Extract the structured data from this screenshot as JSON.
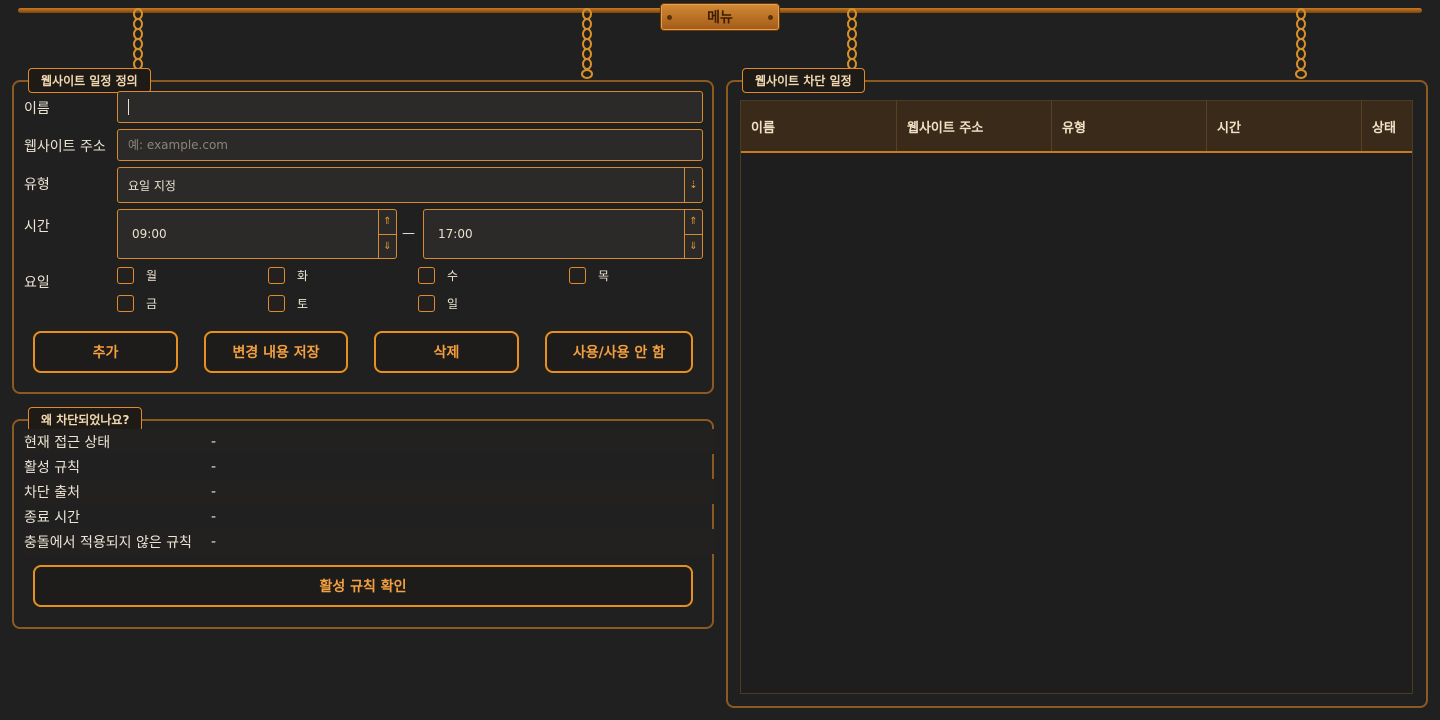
{
  "menu": {
    "title": "메뉴"
  },
  "definition_panel": {
    "title": "웹사이트 일정 정의",
    "name_label": "이름",
    "name_value": "",
    "url_label": "웹사이트 주소",
    "url_placeholder": "예: example.com",
    "type_label": "유형",
    "type_value": "요일 지정",
    "time_label": "시간",
    "time_start": "09:00",
    "time_end": "17:00",
    "time_separator": "—",
    "days_label": "요일",
    "days": [
      "월",
      "화",
      "수",
      "목",
      "금",
      "토",
      "일"
    ],
    "buttons": {
      "add": "추가",
      "save": "변경 내용 저장",
      "delete": "삭제",
      "toggle": "사용/사용 안 함"
    }
  },
  "why_panel": {
    "title": "왜 차단되었나요?",
    "rows": [
      {
        "key": "현재 접근 상태",
        "value": "-"
      },
      {
        "key": "활성 규칙",
        "value": "-"
      },
      {
        "key": "차단 출처",
        "value": "-"
      },
      {
        "key": "종료 시간",
        "value": "-"
      },
      {
        "key": "충돌에서 적용되지 않은 규칙",
        "value": "-"
      }
    ],
    "check_button": "활성 규칙 확인"
  },
  "schedule_panel": {
    "title": "웹사이트 차단 일정",
    "columns": [
      "이름",
      "웹사이트 주소",
      "유형",
      "시간",
      "상태"
    ]
  },
  "colors": {
    "accent": "#e8901e",
    "background": "#202020",
    "border": "#8a5a20"
  }
}
